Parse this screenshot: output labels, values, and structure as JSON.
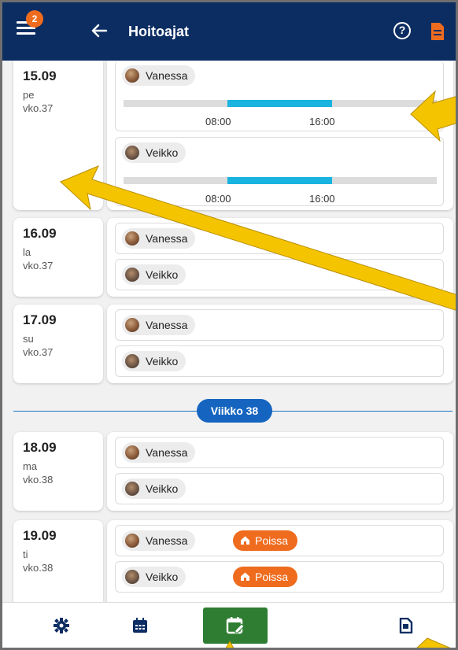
{
  "header": {
    "title": "Hoitoajat",
    "badge_count": "2",
    "help_label": "?",
    "colors": {
      "bg": "#0c2d62",
      "badge": "#ef6c1e"
    }
  },
  "days": [
    {
      "date": "15.09",
      "weekday": "pe",
      "week": "vko.37",
      "entries": [
        {
          "name": "Vanessa",
          "start": "08:00",
          "end": "16:00"
        },
        {
          "name": "Veikko",
          "start": "08:00",
          "end": "16:00"
        }
      ]
    },
    {
      "date": "16.09",
      "weekday": "la",
      "week": "vko.37",
      "entries": [
        {
          "name": "Vanessa"
        },
        {
          "name": "Veikko"
        }
      ]
    },
    {
      "date": "17.09",
      "weekday": "su",
      "week": "vko.37",
      "entries": [
        {
          "name": "Vanessa"
        },
        {
          "name": "Veikko"
        }
      ]
    },
    {
      "date": "18.09",
      "weekday": "ma",
      "week": "vko.38",
      "entries": [
        {
          "name": "Vanessa"
        },
        {
          "name": "Veikko"
        }
      ]
    },
    {
      "date": "19.09",
      "weekday": "ti",
      "week": "vko.38",
      "entries": [
        {
          "name": "Vanessa",
          "status": "Poissa"
        },
        {
          "name": "Veikko",
          "status": "Poissa"
        }
      ]
    }
  ],
  "week_divider": {
    "label": "Viikko 38"
  },
  "bottom_nav": {
    "items": [
      "settings-icon",
      "calendar-icon",
      "calendar-edit-icon",
      "document-icon"
    ],
    "active_color": "#2e7d32"
  },
  "colors": {
    "timeline_fill": "#18b3de",
    "timeline_track": "#dcdcdc",
    "absent": "#ef6c1e",
    "arrow": "#f5c400"
  }
}
